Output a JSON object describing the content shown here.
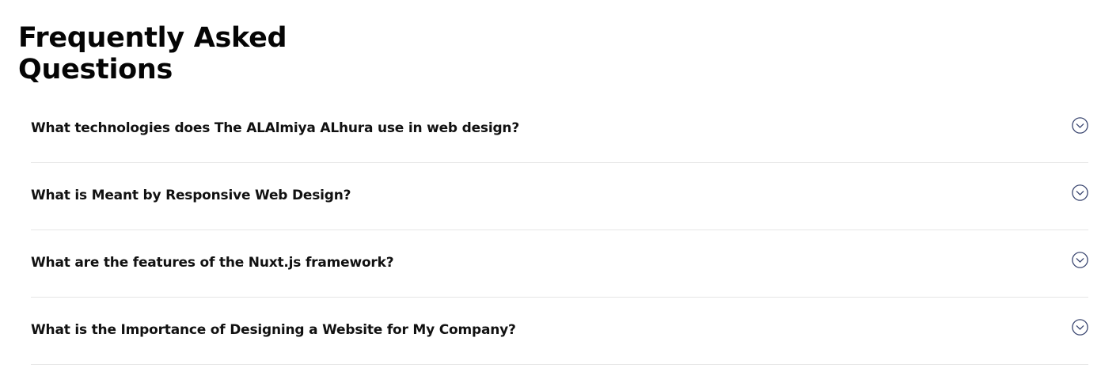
{
  "faq": {
    "title": "Frequently Asked Questions",
    "items": [
      {
        "question": "What technologies does The ALAlmiya ALhura use in web design?",
        "icon": "chevron-down-circle-icon"
      },
      {
        "question": "What is Meant by Responsive Web Design?",
        "icon": "chevron-down-circle-icon"
      },
      {
        "question": "What are the features of the Nuxt.js framework?",
        "icon": "chevron-down-circle-icon"
      },
      {
        "question": "What is the Importance of Designing a Website for My Company?",
        "icon": "chevron-down-circle-icon"
      }
    ],
    "colors": {
      "heading": "#050505",
      "question": "#111111",
      "icon": "#3a4670",
      "divider": "#e6e6e6"
    }
  }
}
